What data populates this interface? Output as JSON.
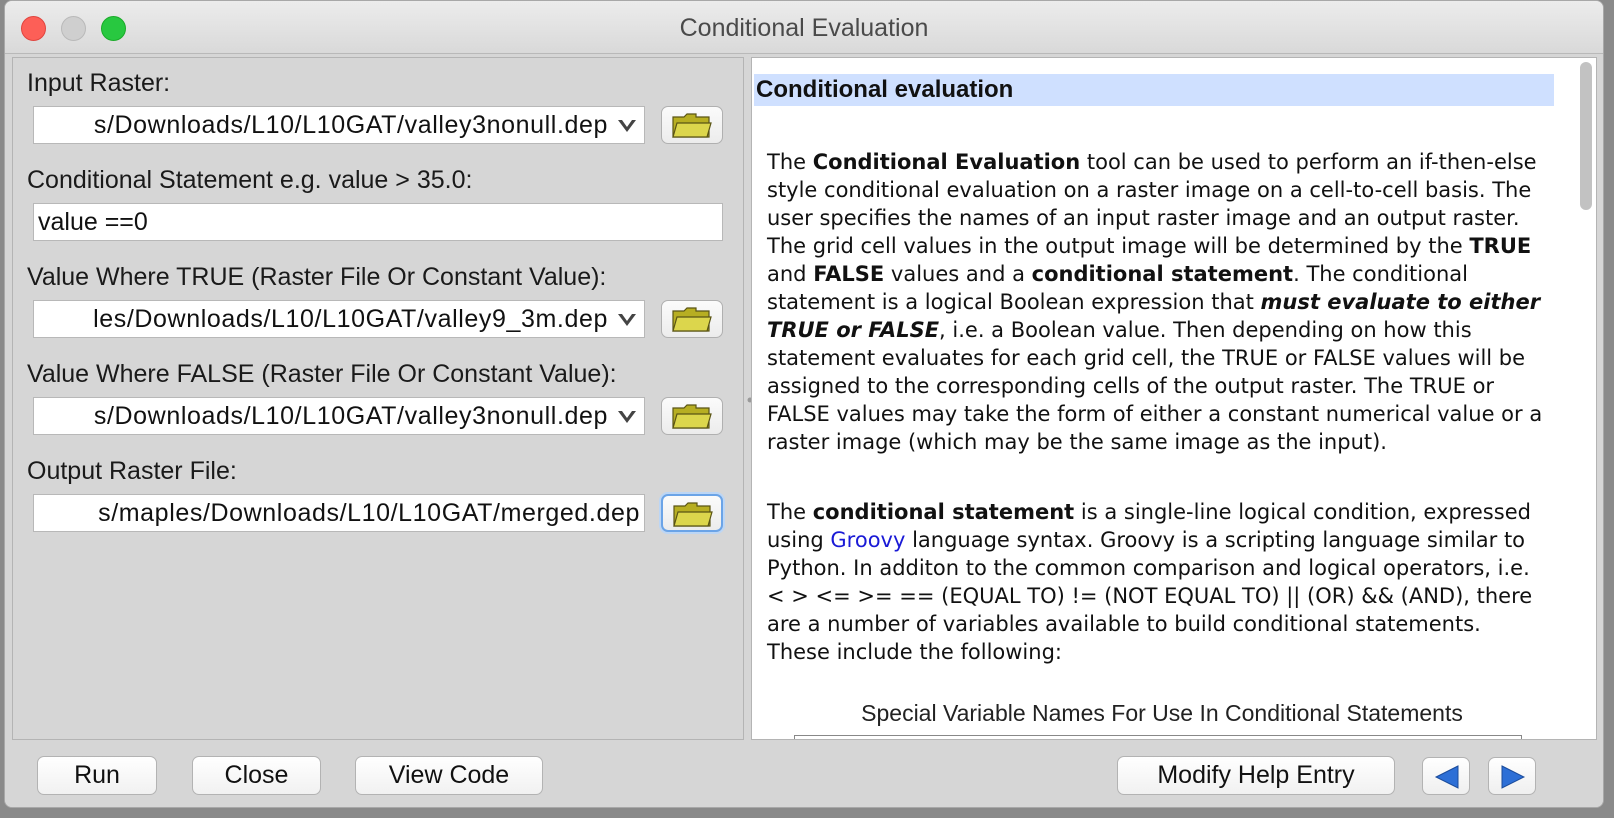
{
  "window": {
    "title": "Conditional Evaluation"
  },
  "form": {
    "input_raster": {
      "label": "Input Raster:",
      "value": "s/Downloads/L10/L10GAT/valley3nonull.dep"
    },
    "conditional": {
      "label": "Conditional Statement e.g. value > 35.0:",
      "value": "value ==0"
    },
    "value_true": {
      "label": "Value Where TRUE (Raster File Or Constant Value):",
      "value": "les/Downloads/L10/L10GAT/valley9_3m.dep"
    },
    "value_false": {
      "label": "Value Where FALSE (Raster File Or Constant Value):",
      "value": "s/Downloads/L10/L10GAT/valley3nonull.dep"
    },
    "output_raster": {
      "label": "Output Raster File:",
      "value": "s/maples/Downloads/L10/L10GAT/merged.dep"
    }
  },
  "help": {
    "heading": "Conditional evaluation",
    "p1": [
      "The ",
      "Conditional Evaluation",
      " tool can be used to perform an if-then-else style conditional evaluation on a raster image on a cell-to-cell basis. The user specifies the names of an input raster image and an output raster. The grid cell values in the output image will be determined by the ",
      "TRUE",
      " and ",
      "FALSE",
      " values and a ",
      "conditional statement",
      ". The conditional statement is a logical Boolean expression that ",
      "must evaluate to either TRUE or FALSE",
      ", i.e. a Boolean value. Then depending on how this statement evaluates for each grid cell, the TRUE or FALSE values will be assigned to the corresponding cells of the output raster. The TRUE or FALSE values may take the form of either a constant numerical value or a raster image (which may be the same image as the input)."
    ],
    "p2": [
      "The ",
      "conditional statement",
      " is a single-line logical condition, expressed using ",
      "Groovy",
      " language syntax. Groovy is a scripting language similar to Python. In additon to the common comparison and logical operators, i.e. < > <= >= == (EQUAL TO) != (NOT EQUAL TO) || (OR) && (AND), there are a number of variables available to build conditional statements. These include the following:"
    ],
    "table_caption": "Special Variable Names For Use In Conditional Statements"
  },
  "buttons": {
    "run": "Run",
    "close": "Close",
    "view_code": "View Code",
    "modify_help": "Modify Help Entry"
  },
  "colors": {
    "heading_bg": "#cfe0ff",
    "link": "#1a1ad6",
    "nav_arrow": "#2d6fd6",
    "folder": "#d8d24a"
  }
}
